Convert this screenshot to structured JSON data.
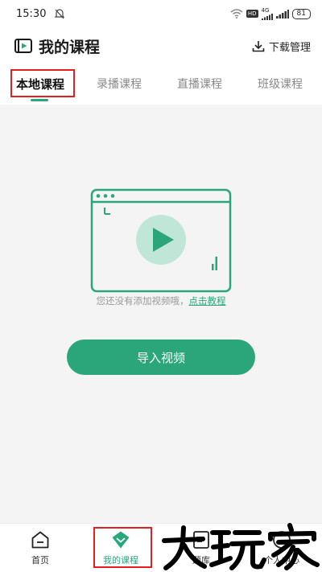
{
  "status_bar": {
    "time": "15:30",
    "hd": "HD",
    "network": "4G",
    "battery": "81"
  },
  "header": {
    "title": "我的课程",
    "download_label": "下载管理"
  },
  "tabs": [
    {
      "label": "本地课程",
      "active": true
    },
    {
      "label": "录播课程",
      "active": false
    },
    {
      "label": "直播课程",
      "active": false
    },
    {
      "label": "班级课程",
      "active": false
    }
  ],
  "empty_state": {
    "message": "您还没有添加视频哦，",
    "link": "点击教程"
  },
  "import_button": {
    "label": "导入视频"
  },
  "bottom_nav": [
    {
      "label": "首页",
      "icon": "home-icon",
      "active": false
    },
    {
      "label": "我的课程",
      "icon": "course-icon",
      "active": true
    },
    {
      "label": "题库",
      "icon": "question-bank-icon",
      "active": false
    },
    {
      "label": "个人中心",
      "icon": "profile-icon",
      "active": false
    }
  ],
  "watermark": {
    "text": "大玩家"
  },
  "colors": {
    "accent": "#27a97b",
    "button": "#2aa67a",
    "highlight_box": "#e81e1e"
  }
}
